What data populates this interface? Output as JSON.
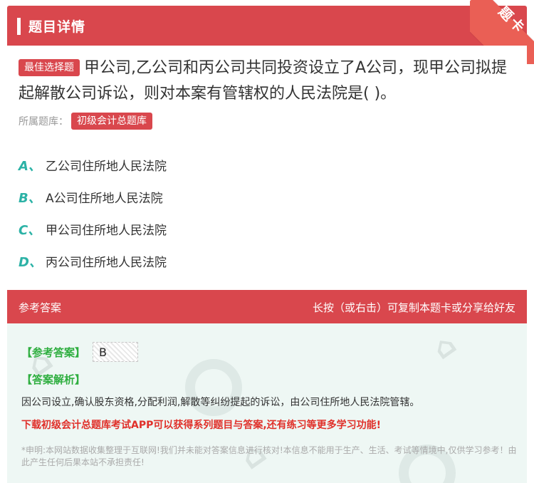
{
  "header": {
    "title": "题目详情"
  },
  "ribbon": {
    "label": "题卡"
  },
  "question": {
    "badge": "最佳选择题",
    "text": "甲公司,乙公司和丙公司共同投资设立了A公司，现甲公司拟提起解散公司诉讼，则对本案有管辖权的人民法院是( )。"
  },
  "bank": {
    "label": "所属题库：",
    "name": "初级会计总题库"
  },
  "options": [
    {
      "letter": "A、",
      "text": "乙公司住所地人民法院"
    },
    {
      "letter": "B、",
      "text": "A公司住所地人民法院"
    },
    {
      "letter": "C、",
      "text": "甲公司住所地人民法院"
    },
    {
      "letter": "D、",
      "text": "丙公司住所地人民法院"
    }
  ],
  "answer_header": {
    "left": "参考答案",
    "right": "长按（或右击）可复制本题卡或分享给好友"
  },
  "answer": {
    "ref_label": "【参考答案】",
    "value": "B",
    "analysis_label": "【答案解析】",
    "analysis": "因公司设立,确认股东资格,分配利润,解散等纠纷提起的诉讼，由公司住所地人民法院管辖。",
    "download": "下载初级会计总题库考试APP可以获得系列题目与答案,还有练习等更多学习功能!",
    "disclaimer": "*申明:本网站数据收集整理于互联网!我们并未能对答案信息进行核对!本信息不能用于生产、生活、考试等情境中,仅供学习参考！由此产生任何后果本站不承担责任!"
  },
  "colors": {
    "brand_red": "#d9474d",
    "option_teal": "#2cb2a6",
    "answer_green": "#2eae3f",
    "warning_red": "#e0302a"
  }
}
